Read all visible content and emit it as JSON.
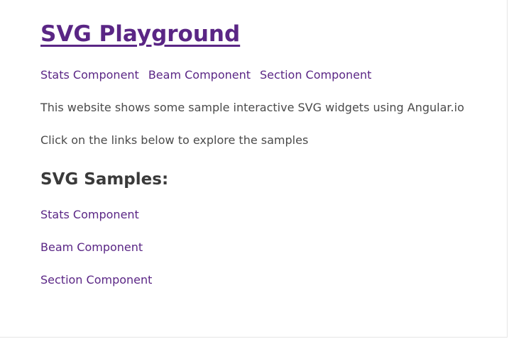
{
  "site": {
    "title": "SVG Playground"
  },
  "top_nav": {
    "items": [
      {
        "label": "Stats Component"
      },
      {
        "label": "Beam Component"
      },
      {
        "label": "Section Component"
      }
    ]
  },
  "main": {
    "intro": "This website shows some sample interactive SVG widgets using Angular.io",
    "instruction": "Click on the links below to explore the samples",
    "samples_heading": "SVG Samples:",
    "samples": [
      {
        "label": "Stats Component"
      },
      {
        "label": "Beam Component"
      },
      {
        "label": "Section Component"
      }
    ]
  },
  "colors": {
    "link": "#5a2685",
    "text": "#4a4a4a",
    "heading": "#3a3a3a",
    "background": "#ffffff"
  }
}
